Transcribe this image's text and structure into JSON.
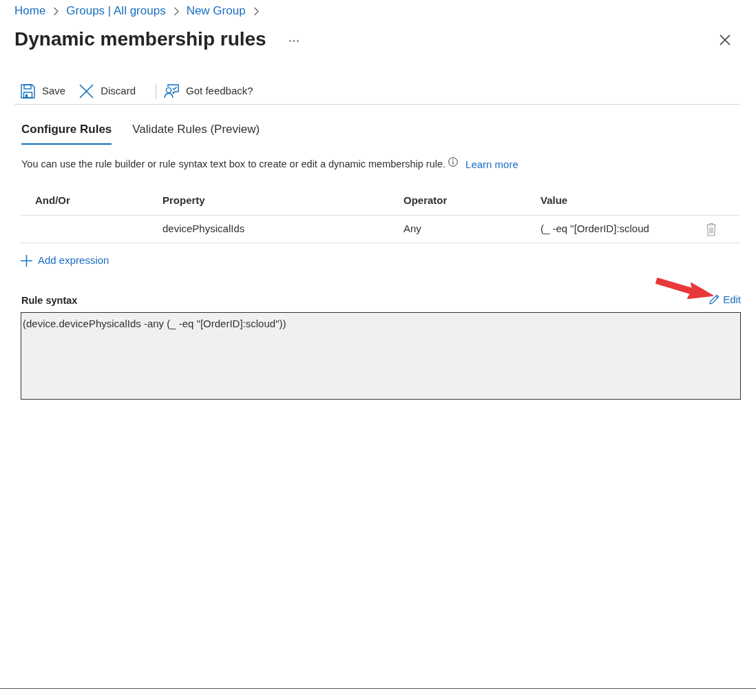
{
  "breadcrumb": [
    {
      "label": "Home"
    },
    {
      "label": "Groups | All groups"
    },
    {
      "label": "New Group"
    }
  ],
  "title": "Dynamic membership rules",
  "toolbar": [
    {
      "kind": "save",
      "label": "Save"
    },
    {
      "kind": "discard",
      "label": "Discard"
    },
    {
      "kind": "feedback",
      "label": "Got feedback?"
    }
  ],
  "tabs": [
    {
      "label": "Configure Rules",
      "selected": true
    },
    {
      "label": "Validate Rules (Preview)",
      "selected": false
    }
  ],
  "description": {
    "text": "You can use the rule builder or rule syntax text box to create or edit a dynamic membership rule.",
    "link": "Learn more"
  },
  "rules_table": {
    "columns": [
      "And/Or",
      "Property",
      "Operator",
      "Value"
    ],
    "rows": [
      {
        "property": "devicePhysicalIds",
        "operator": "Any",
        "value": "(_ -eq \"[OrderID]:scloud"
      }
    ]
  },
  "add_expression": "Add expression",
  "rule_syntax": {
    "label": "Rule syntax",
    "edit": "Edit",
    "value": "(device.devicePhysicalIds -any (_ -eq \"[OrderID]:scloud\"))"
  }
}
